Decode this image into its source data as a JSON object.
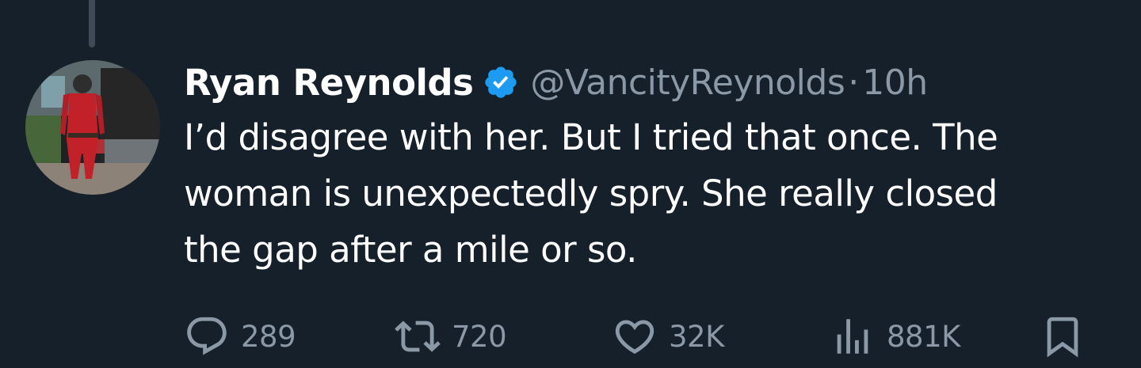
{
  "author": {
    "name": "Ryan Reynolds",
    "handle": "@VancityReynolds",
    "separator": "·",
    "time": "10h",
    "verified": true,
    "verified_color": "#1d9bf0"
  },
  "tweet": {
    "lines": [
      "I’d disagree with her. But I tried that once. The",
      "woman is unexpectedly spry. She really closed",
      "the gap after a mile or so."
    ]
  },
  "actions": {
    "reply": {
      "icon": "reply-icon",
      "count": "289"
    },
    "retweet": {
      "icon": "retweet-icon",
      "count": "720"
    },
    "like": {
      "icon": "heart-icon",
      "count": "32K"
    },
    "views": {
      "icon": "views-chart-icon",
      "count": "881K"
    },
    "bookmark": {
      "icon": "bookmark-icon"
    }
  },
  "colors": {
    "background": "#15202b",
    "text": "#ffffff",
    "secondary": "#8b98a5",
    "thread_line": "#3f4a56"
  }
}
